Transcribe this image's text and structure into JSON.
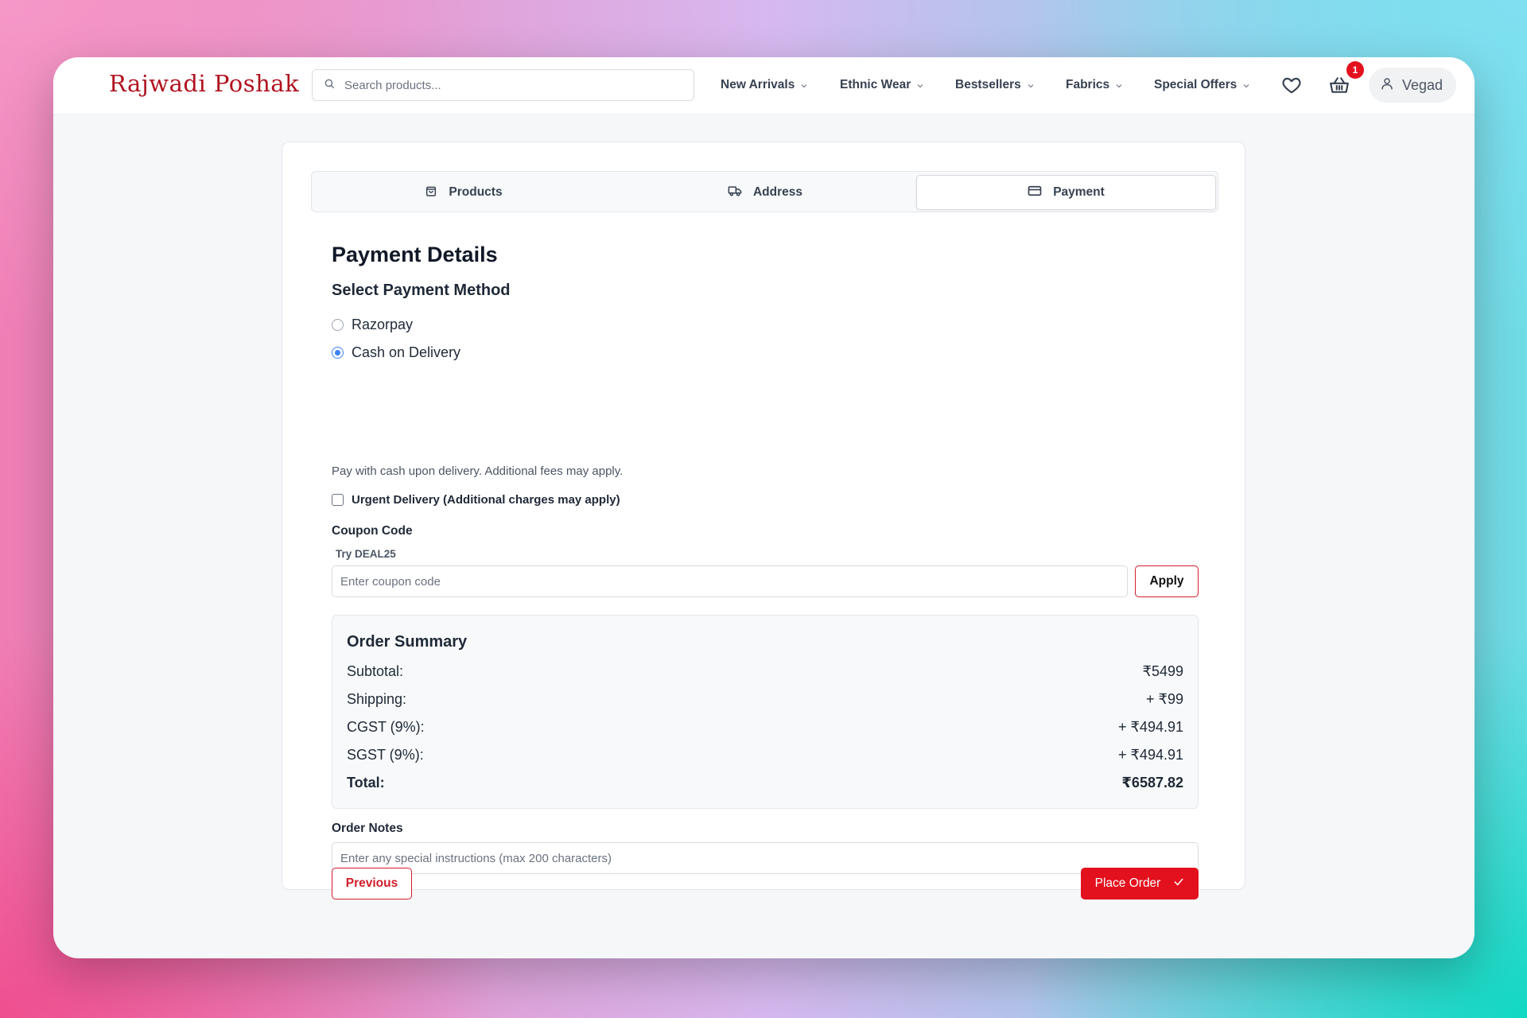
{
  "brand": {
    "name": "Rajwadi Poshak"
  },
  "search": {
    "placeholder": "Search products..."
  },
  "nav": {
    "items": [
      {
        "label": "New Arrivals"
      },
      {
        "label": "Ethnic Wear"
      },
      {
        "label": "Bestsellers"
      },
      {
        "label": "Fabrics"
      },
      {
        "label": "Special Offers"
      }
    ]
  },
  "cart": {
    "count": "1"
  },
  "user": {
    "name": "Vegad"
  },
  "steps": [
    {
      "label": "Products",
      "icon": "shopping-bag-icon"
    },
    {
      "label": "Address",
      "icon": "truck-icon"
    },
    {
      "label": "Payment",
      "icon": "credit-card-icon",
      "active": true
    }
  ],
  "payment": {
    "title": "Payment Details",
    "method_heading": "Select Payment Method",
    "methods": [
      {
        "label": "Razorpay",
        "selected": false
      },
      {
        "label": "Cash on Delivery",
        "selected": true
      }
    ],
    "note": "Pay with cash upon delivery. Additional fees may apply.",
    "urgent_label": "Urgent Delivery (Additional charges may apply)",
    "coupon": {
      "label": "Coupon Code",
      "hint": "Try DEAL25",
      "placeholder": "Enter coupon code",
      "apply_label": "Apply"
    }
  },
  "summary": {
    "title": "Order Summary",
    "rows": [
      {
        "label": "Subtotal:",
        "value": "₹5499"
      },
      {
        "label": "Shipping:",
        "value": "+ ₹99"
      },
      {
        "label": "CGST (9%):",
        "value": "+ ₹494.91"
      },
      {
        "label": "SGST (9%):",
        "value": "+ ₹494.91"
      }
    ],
    "total": {
      "label": "Total:",
      "value": "₹6587.82"
    }
  },
  "notes": {
    "label": "Order Notes",
    "placeholder": "Enter any special instructions (max 200 characters)"
  },
  "actions": {
    "previous_label": "Previous",
    "place_label": "Place Order"
  },
  "colors": {
    "brand_red": "#e3101e",
    "logo_red": "#b0121f",
    "radio_blue": "#3b82f6"
  }
}
